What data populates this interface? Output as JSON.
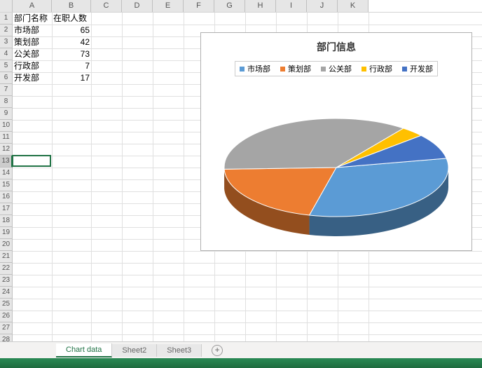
{
  "columns": [
    "A",
    "B",
    "C",
    "D",
    "E",
    "F",
    "G",
    "H",
    "I",
    "J",
    "K"
  ],
  "row_count": 28,
  "selected_row": 13,
  "col_widths": {
    "A": 56,
    "B": 56,
    "default": 44
  },
  "table": {
    "headers": {
      "A": "部门名称",
      "B": "在职人数"
    },
    "rows": [
      {
        "A": "市场部",
        "B": "65"
      },
      {
        "A": "策划部",
        "B": "42"
      },
      {
        "A": "公关部",
        "B": "73"
      },
      {
        "A": "行政部",
        "B": "7"
      },
      {
        "A": "开发部",
        "B": "17"
      }
    ]
  },
  "chart_data": {
    "type": "pie",
    "title": "部门信息",
    "series": [
      {
        "name": "市场部",
        "value": 65,
        "color": "#5B9BD5"
      },
      {
        "name": "策划部",
        "value": 42,
        "color": "#ED7D31"
      },
      {
        "name": "公关部",
        "value": 73,
        "color": "#A5A5A5"
      },
      {
        "name": "行政部",
        "value": 7,
        "color": "#FFC000"
      },
      {
        "name": "开发部",
        "value": 17,
        "color": "#4472C4"
      }
    ]
  },
  "sheets": {
    "tabs": [
      "Chart data",
      "Sheet2",
      "Sheet3"
    ],
    "active": 0,
    "new_sheet_glyph": "+"
  }
}
